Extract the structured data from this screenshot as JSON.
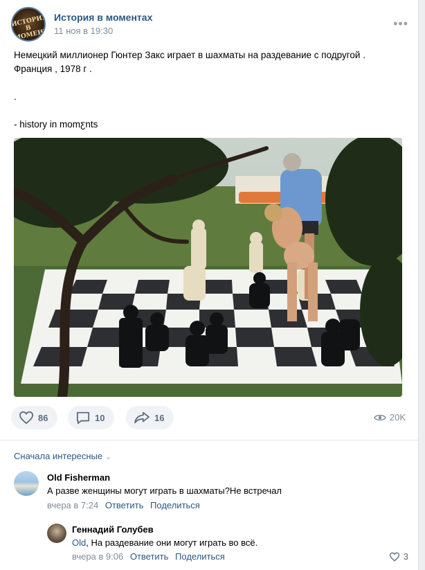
{
  "post": {
    "author": "История в моментах",
    "avatar_text": "ИСТОРИЯ В МОМЕНТАХ",
    "date": "11 ноя в 19:30",
    "text_line1": "Немецкий миллионер Гюнтер Закс играет в шахматы на раздевание с подругой .",
    "text_line2": "Франция , 1978 г .",
    "text_line3": ".",
    "text_line4": "- history in momƹnts"
  },
  "actions": {
    "likes": "86",
    "comments": "10",
    "shares": "16",
    "views": "20K"
  },
  "comments_section": {
    "sort_label": "Сначала интересные"
  },
  "comments": [
    {
      "name": "Old Fisherman",
      "text": "А разве женщины могут играть в шахматы?Не встречал",
      "time": "вчера в 7:24",
      "reply_label": "Ответить",
      "share_label": "Поделиться"
    },
    {
      "name": "Геннадий Голубев",
      "mention": "Old",
      "text": ", На раздевание они могут играть во всё.",
      "time": "вчера в 9:06",
      "reply_label": "Ответить",
      "share_label": "Поделиться",
      "likes": "3"
    }
  ],
  "colors": {
    "link": "#2a5885",
    "muted": "#818c99",
    "button_bg": "#f0f2f5"
  }
}
